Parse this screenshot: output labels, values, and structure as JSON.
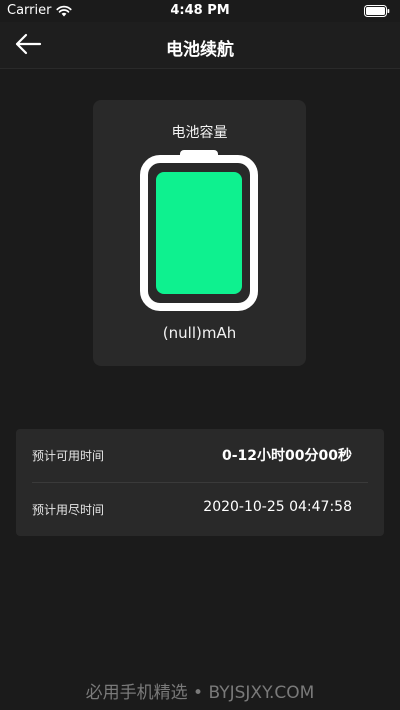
{
  "status_bar": {
    "carrier": "Carrier",
    "time": "4:48 PM"
  },
  "nav": {
    "title": "电池续航"
  },
  "battery_card": {
    "label": "电池容量",
    "value": "(null)mAh",
    "fill_color": "#0ef18f"
  },
  "info": {
    "rows": [
      {
        "label": "预计可用时间",
        "value": "0-12小时00分00秒"
      },
      {
        "label": "预计用尽时间",
        "value": "2020-10-25 04:47:58"
      }
    ]
  },
  "watermark": {
    "text": "必用手机精选 • BYJSJXY.COM"
  }
}
